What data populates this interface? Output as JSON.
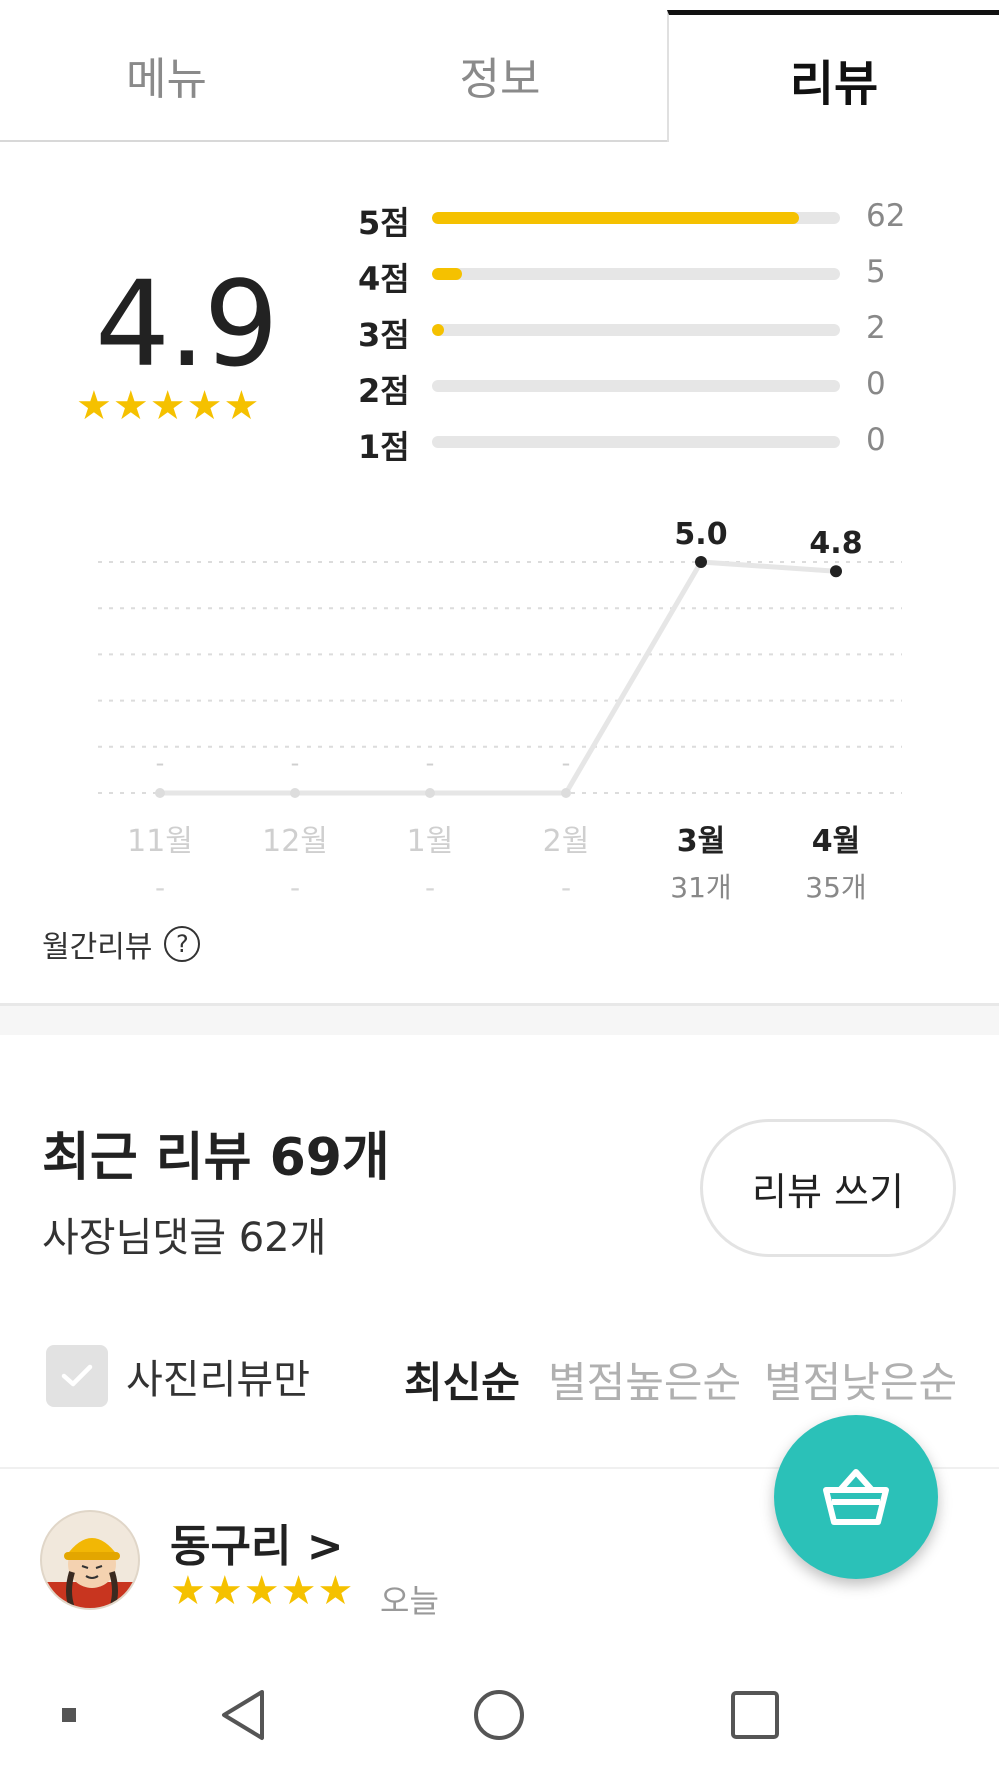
{
  "tabs": [
    {
      "label": "메뉴",
      "active": false
    },
    {
      "label": "정보",
      "active": false
    },
    {
      "label": "리뷰",
      "active": true
    }
  ],
  "summary": {
    "score": "4.9",
    "stars": "★★★★★"
  },
  "distribution": [
    {
      "label": "5점",
      "count": "62",
      "value": 62
    },
    {
      "label": "4점",
      "count": "5",
      "value": 5
    },
    {
      "label": "3점",
      "count": "2",
      "value": 2
    },
    {
      "label": "2점",
      "count": "0",
      "value": 0
    },
    {
      "label": "1점",
      "count": "0",
      "value": 0
    }
  ],
  "chart_data": {
    "type": "line",
    "categories": [
      "11월",
      "12월",
      "1월",
      "2월",
      "3월",
      "4월"
    ],
    "values": [
      0,
      0,
      0,
      0,
      5.0,
      4.8
    ],
    "point_labels": [
      "-",
      "-",
      "-",
      "-",
      "5.0",
      "4.8"
    ],
    "counts": [
      "-",
      "-",
      "-",
      "-",
      "31개",
      "35개"
    ],
    "active": [
      false,
      false,
      false,
      false,
      true,
      true
    ],
    "ylim": [
      0,
      5
    ],
    "grid": true,
    "title": "",
    "xlabel": "",
    "ylabel": ""
  },
  "monthly_review": {
    "label": "월간리뷰",
    "help_icon": "?"
  },
  "recent": {
    "title": "최근 리뷰 69개",
    "owner_reply": "사장님댓글 62개",
    "write_button": "리뷰 쓰기"
  },
  "filters": {
    "photo_only": "사진리뷰만",
    "photo_only_checked": false,
    "sort_options": [
      "최신순",
      "별점높은순",
      "별점낮은순"
    ],
    "active_sort": "최신순"
  },
  "review": {
    "name": "동구리 >",
    "stars": "★★★★★",
    "date": "오늘"
  },
  "colors": {
    "star": "#f5c100",
    "fab": "#2bc1b8",
    "line": "#e6e6e6",
    "text": "#222222"
  },
  "icons": {
    "fab": "basket-icon",
    "help": "question-circle-icon",
    "nav": [
      "dot-icon",
      "back-triangle-icon",
      "home-circle-icon",
      "recents-square-icon"
    ]
  }
}
